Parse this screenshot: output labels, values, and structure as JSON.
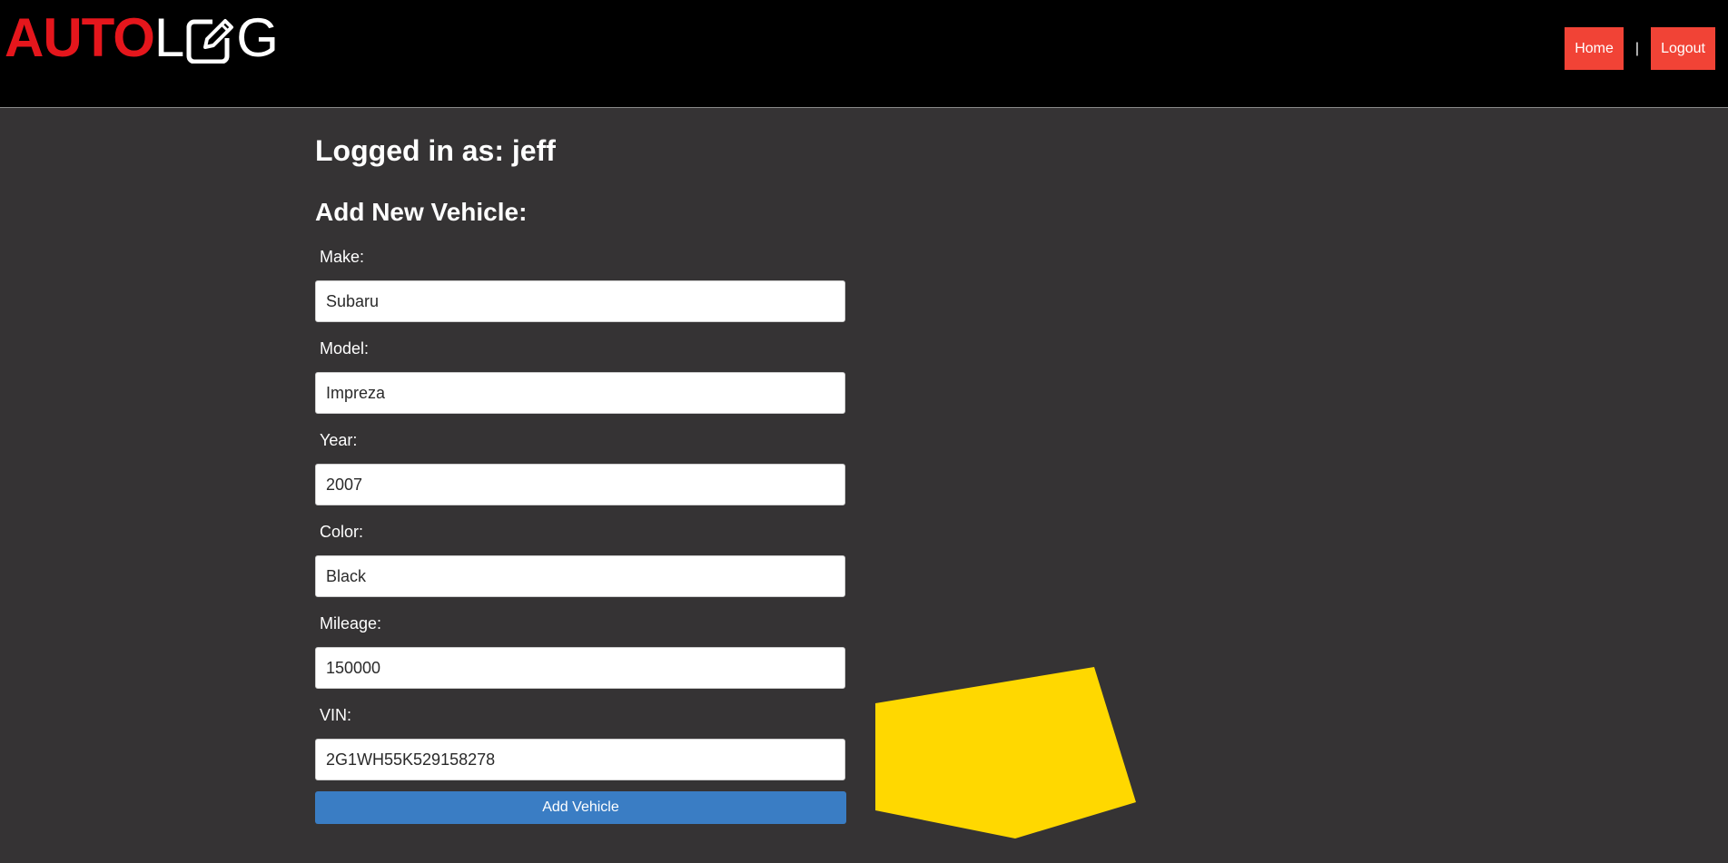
{
  "header": {
    "logo_part1": "AUTO",
    "logo_part2": "L",
    "logo_part3": "G",
    "nav": {
      "home_label": "Home",
      "separator": "|",
      "logout_label": "Logout"
    }
  },
  "main": {
    "logged_in_text": "Logged in as: jeff",
    "form_title": "Add New Vehicle:",
    "fields": [
      {
        "label": "Make:",
        "value": "Subaru"
      },
      {
        "label": "Model:",
        "value": "Impreza"
      },
      {
        "label": "Year:",
        "value": "2007"
      },
      {
        "label": "Color:",
        "value": "Black"
      },
      {
        "label": "Mileage:",
        "value": "150000"
      },
      {
        "label": "VIN:",
        "value": "2G1WH55K529158278"
      }
    ],
    "submit_label": "Add Vehicle"
  },
  "colors": {
    "header_bg": "#000000",
    "page_bg": "#353334",
    "brand_red": "#e5161c",
    "nav_button": "#f14336",
    "submit_button": "#3a7dc4",
    "overlay_marker": "#ffd800"
  },
  "icons": {
    "logo_o": "edit-square-icon"
  }
}
